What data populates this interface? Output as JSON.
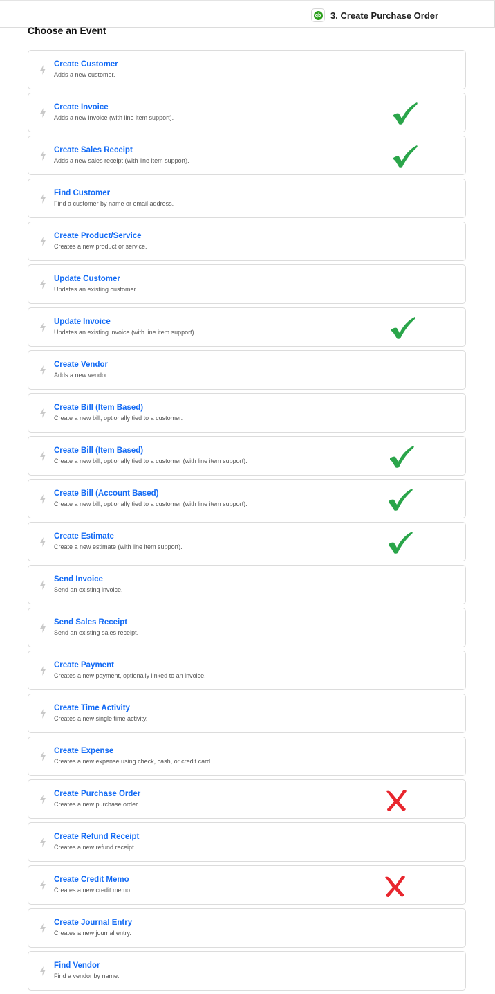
{
  "header": {
    "step_title": "3. Create Purchase Order",
    "app_badge": "qb"
  },
  "section": {
    "heading": "Choose an Event"
  },
  "colors": {
    "title_link": "#136bf5",
    "check": "#2aa54a",
    "cross": "#e8262e"
  },
  "events": [
    {
      "title": "Create Customer",
      "desc": "Adds a new customer.",
      "mark": null
    },
    {
      "title": "Create Invoice",
      "desc": "Adds a new invoice (with line item support).",
      "mark": "check"
    },
    {
      "title": "Create Sales Receipt",
      "desc": "Adds a new sales receipt (with line item support).",
      "mark": "check"
    },
    {
      "title": "Find Customer",
      "desc": "Find a customer by name or email address.",
      "mark": null
    },
    {
      "title": "Create Product/Service",
      "desc": "Creates a new product or service.",
      "mark": null
    },
    {
      "title": "Update Customer",
      "desc": "Updates an existing customer.",
      "mark": null
    },
    {
      "title": "Update Invoice",
      "desc": "Updates an existing invoice (with line item support).",
      "mark": "check"
    },
    {
      "title": "Create Vendor",
      "desc": "Adds a new vendor.",
      "mark": null
    },
    {
      "title": "Create Bill (Item Based)",
      "desc": "Create a new bill, optionally tied to a customer.",
      "mark": null
    },
    {
      "title": "Create Bill (Item Based)",
      "desc": "Create a new bill, optionally tied to a customer (with line item support).",
      "mark": "check"
    },
    {
      "title": "Create Bill (Account Based)",
      "desc": "Create a new bill, optionally tied to a customer (with line item support).",
      "mark": "check"
    },
    {
      "title": "Create Estimate",
      "desc": "Create a new estimate (with line item support).",
      "mark": "check"
    },
    {
      "title": "Send Invoice",
      "desc": "Send an existing invoice.",
      "mark": null
    },
    {
      "title": "Send Sales Receipt",
      "desc": "Send an existing sales receipt.",
      "mark": null
    },
    {
      "title": "Create Payment",
      "desc": "Creates a new payment, optionally linked to an invoice.",
      "mark": null
    },
    {
      "title": "Create Time Activity",
      "desc": "Creates a new single time activity.",
      "mark": null
    },
    {
      "title": "Create Expense",
      "desc": "Creates a new expense using check, cash, or credit card.",
      "mark": null
    },
    {
      "title": "Create Purchase Order",
      "desc": "Creates a new purchase order.",
      "mark": "cross"
    },
    {
      "title": "Create Refund Receipt",
      "desc": "Creates a new refund receipt.",
      "mark": null
    },
    {
      "title": "Create Credit Memo",
      "desc": "Creates a new credit memo.",
      "mark": "cross"
    },
    {
      "title": "Create Journal Entry",
      "desc": "Creates a new journal entry.",
      "mark": null
    },
    {
      "title": "Find Vendor",
      "desc": "Find a vendor by name.",
      "mark": null
    }
  ]
}
